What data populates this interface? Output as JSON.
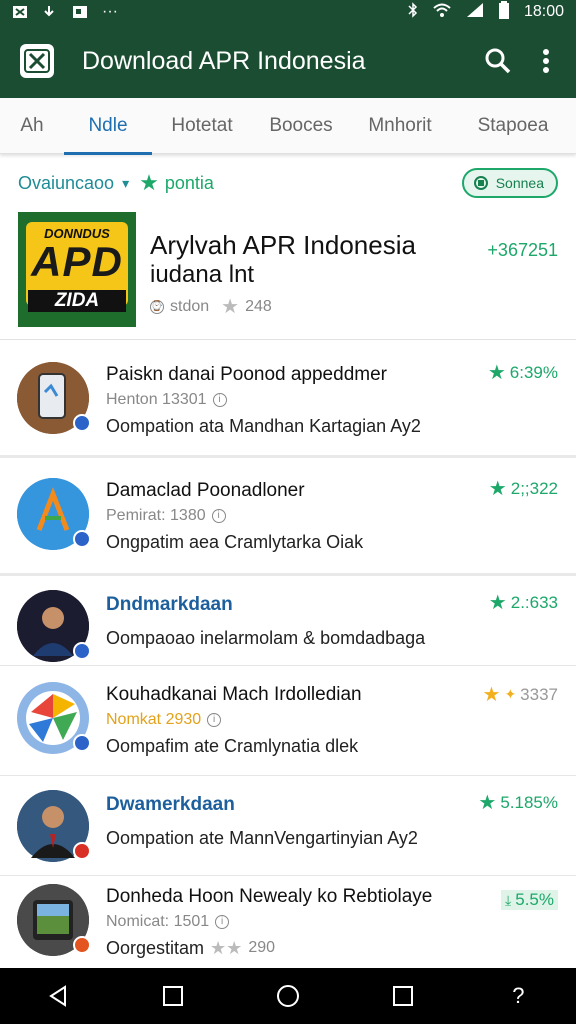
{
  "status_bar": {
    "time": "18:00"
  },
  "app_bar": {
    "title": "Download APR Indonesia"
  },
  "tabs": [
    {
      "label": "Ah",
      "active": false
    },
    {
      "label": "Ndle",
      "active": true
    },
    {
      "label": "Hotetat",
      "active": false
    },
    {
      "label": "Booces",
      "active": false
    },
    {
      "label": "Mnhorit",
      "active": false
    },
    {
      "label": "Stapoea",
      "active": false
    }
  ],
  "filter": {
    "label": "Ovaiuncaoo",
    "sub_label": "pontia",
    "chip_label": "Sonnea"
  },
  "featured": {
    "logo_line1": "DONNDUS",
    "logo_line2": "APD",
    "logo_line3": "ZIDA",
    "title": "Arylvah APR Indonesia",
    "subtitle": "iudana lnt",
    "meta_label": "stdon",
    "meta_count": "248",
    "count": "+367251"
  },
  "items": [
    {
      "title": "Paiskn danai Poonod appeddmer",
      "meta": "Henton 13301",
      "desc": "Oompation ata Mandhan Kartagian Ay2",
      "rating": "6:39%",
      "title_style": "normal",
      "meta_style": "normal",
      "rating_style": "green"
    },
    {
      "title": "Damaclad Poonadloner",
      "meta": "Pemirat: 1380",
      "desc": "Ongpatim aea Cramlytarka Oiak",
      "rating": "2;;322",
      "title_style": "normal",
      "meta_style": "normal",
      "rating_style": "green"
    },
    {
      "title": "Dndmarkdaan",
      "meta": "",
      "desc": "Oompaoao inelarmolam & bomdadbaga",
      "rating": "2.:633",
      "title_style": "blue",
      "meta_style": "none",
      "rating_style": "green"
    },
    {
      "title": "Kouhadkanai Mach Irdolledian",
      "meta": "Nomkat 2930",
      "desc": "Oompafim ate Cramlynatia dlek",
      "rating": "3337",
      "title_style": "normal",
      "meta_style": "gold",
      "rating_style": "gold"
    },
    {
      "title": "Dwamerkdaan",
      "meta": "",
      "desc": "Oompation ate MannVengartinyian Ay2",
      "rating": "5.185%",
      "title_style": "blue",
      "meta_style": "none",
      "rating_style": "green"
    },
    {
      "title": "Donheda Hoon Newealy ko Rebtiolaye",
      "meta": "Nomicat: 1501",
      "desc": "Oorgestitam",
      "desc_count": "290",
      "rating": "5.5%",
      "title_style": "normal",
      "meta_style": "normal",
      "rating_style": "green"
    }
  ]
}
